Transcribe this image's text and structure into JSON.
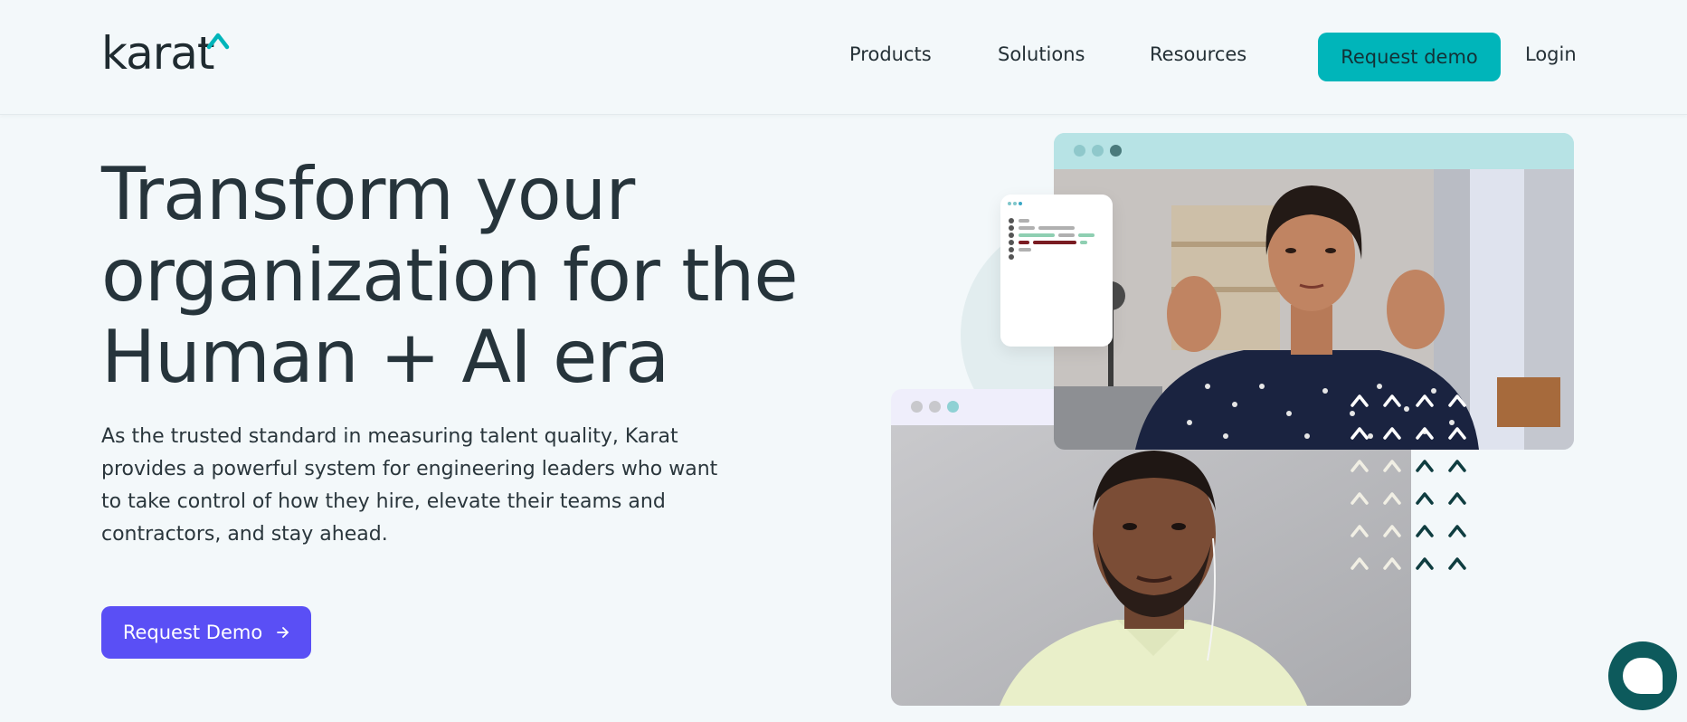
{
  "header": {
    "logo_text": "karat",
    "nav": [
      "Products",
      "Solutions",
      "Resources"
    ],
    "cta_label": "Request demo",
    "login_label": "Login"
  },
  "hero": {
    "title_lines": [
      "Transform your",
      "organization for the",
      "Human + AI era"
    ],
    "description": "As the trusted standard in measuring talent quality, Karat provides a powerful system for engineering leaders who want to take control of how they hire, elevate their teams and contractors, and stay ahead.",
    "cta_label": "Request Demo"
  },
  "icons": {
    "logo_caret": "caret-up-icon",
    "cta_arrow": "arrow-right-icon",
    "chat": "chat-bubble-icon"
  },
  "colors": {
    "accent_teal": "#00b5ba",
    "primary_purple": "#5a4ff5",
    "text_dark": "#26343b",
    "chat_green": "#0d5a5c"
  }
}
